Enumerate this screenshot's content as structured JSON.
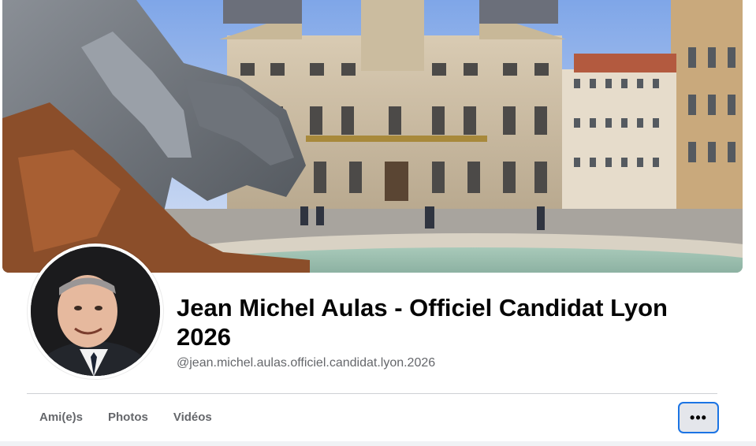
{
  "profile": {
    "name": "Jean Michel Aulas - Officiel Candidat Lyon 2026",
    "handle": "@jean.michel.aulas.officiel.candidat.lyon.2026"
  },
  "tabs": [
    {
      "label": "Ami(e)s"
    },
    {
      "label": "Photos"
    },
    {
      "label": "Vidéos"
    }
  ],
  "more_button": {
    "label": "•••",
    "icon": "more-horizontal-icon"
  },
  "colors": {
    "name_text": "#050505",
    "secondary_text": "#65676b",
    "focus_ring": "#1b74e4",
    "button_bg": "#e4e6eb"
  }
}
